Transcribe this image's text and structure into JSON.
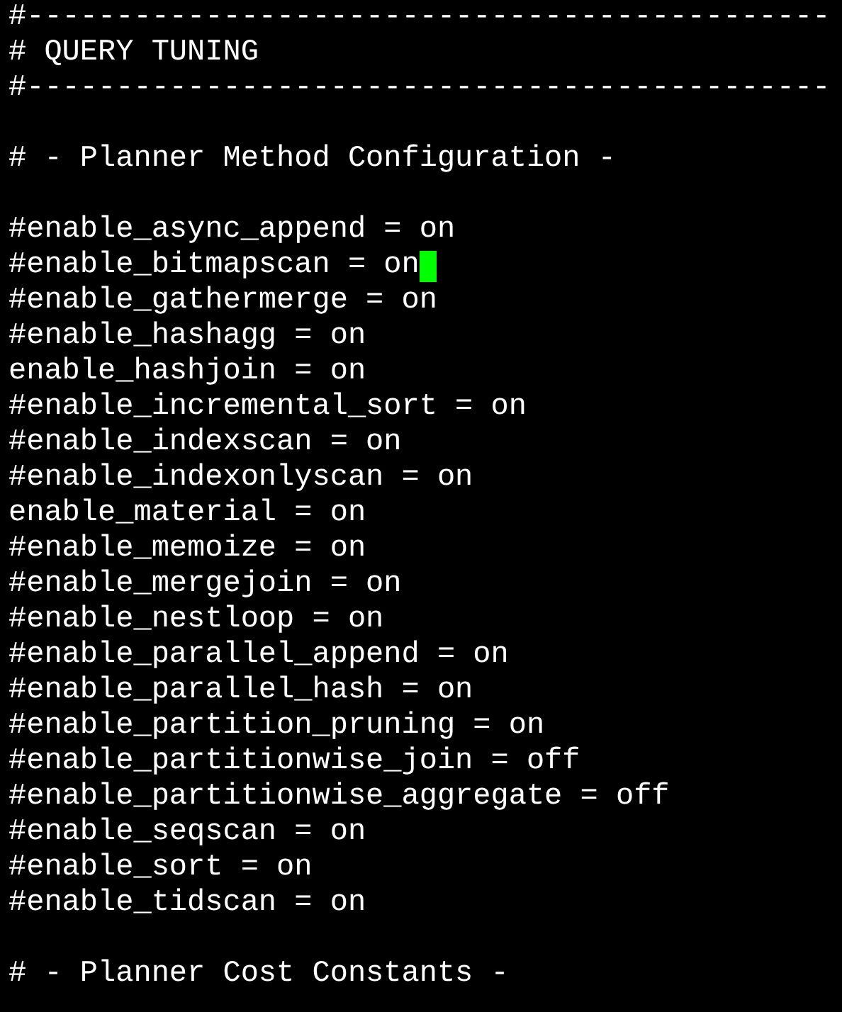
{
  "lines": [
    {
      "kind": "text",
      "text": "#---------------------------------------------",
      "cursor": false
    },
    {
      "kind": "text",
      "text": "# QUERY TUNING",
      "cursor": false
    },
    {
      "kind": "text",
      "text": "#---------------------------------------------",
      "cursor": false
    },
    {
      "kind": "blank"
    },
    {
      "kind": "text",
      "text": "# - Planner Method Configuration -",
      "cursor": false
    },
    {
      "kind": "blank"
    },
    {
      "kind": "text",
      "text": "#enable_async_append = on",
      "cursor": false
    },
    {
      "kind": "text",
      "text": "#enable_bitmapscan = on",
      "cursor": true
    },
    {
      "kind": "text",
      "text": "#enable_gathermerge = on",
      "cursor": false
    },
    {
      "kind": "text",
      "text": "#enable_hashagg = on",
      "cursor": false
    },
    {
      "kind": "text",
      "text": "enable_hashjoin = on",
      "cursor": false
    },
    {
      "kind": "text",
      "text": "#enable_incremental_sort = on",
      "cursor": false
    },
    {
      "kind": "text",
      "text": "#enable_indexscan = on",
      "cursor": false
    },
    {
      "kind": "text",
      "text": "#enable_indexonlyscan = on",
      "cursor": false
    },
    {
      "kind": "text",
      "text": "enable_material = on",
      "cursor": false
    },
    {
      "kind": "text",
      "text": "#enable_memoize = on",
      "cursor": false
    },
    {
      "kind": "text",
      "text": "#enable_mergejoin = on",
      "cursor": false
    },
    {
      "kind": "text",
      "text": "#enable_nestloop = on",
      "cursor": false
    },
    {
      "kind": "text",
      "text": "#enable_parallel_append = on",
      "cursor": false
    },
    {
      "kind": "text",
      "text": "#enable_parallel_hash = on",
      "cursor": false
    },
    {
      "kind": "text",
      "text": "#enable_partition_pruning = on",
      "cursor": false
    },
    {
      "kind": "text",
      "text": "#enable_partitionwise_join = off",
      "cursor": false
    },
    {
      "kind": "text",
      "text": "#enable_partitionwise_aggregate = off",
      "cursor": false
    },
    {
      "kind": "text",
      "text": "#enable_seqscan = on",
      "cursor": false
    },
    {
      "kind": "text",
      "text": "#enable_sort = on",
      "cursor": false
    },
    {
      "kind": "text",
      "text": "#enable_tidscan = on",
      "cursor": false
    },
    {
      "kind": "blank"
    },
    {
      "kind": "text",
      "text": "# - Planner Cost Constants -",
      "cursor": false
    }
  ]
}
